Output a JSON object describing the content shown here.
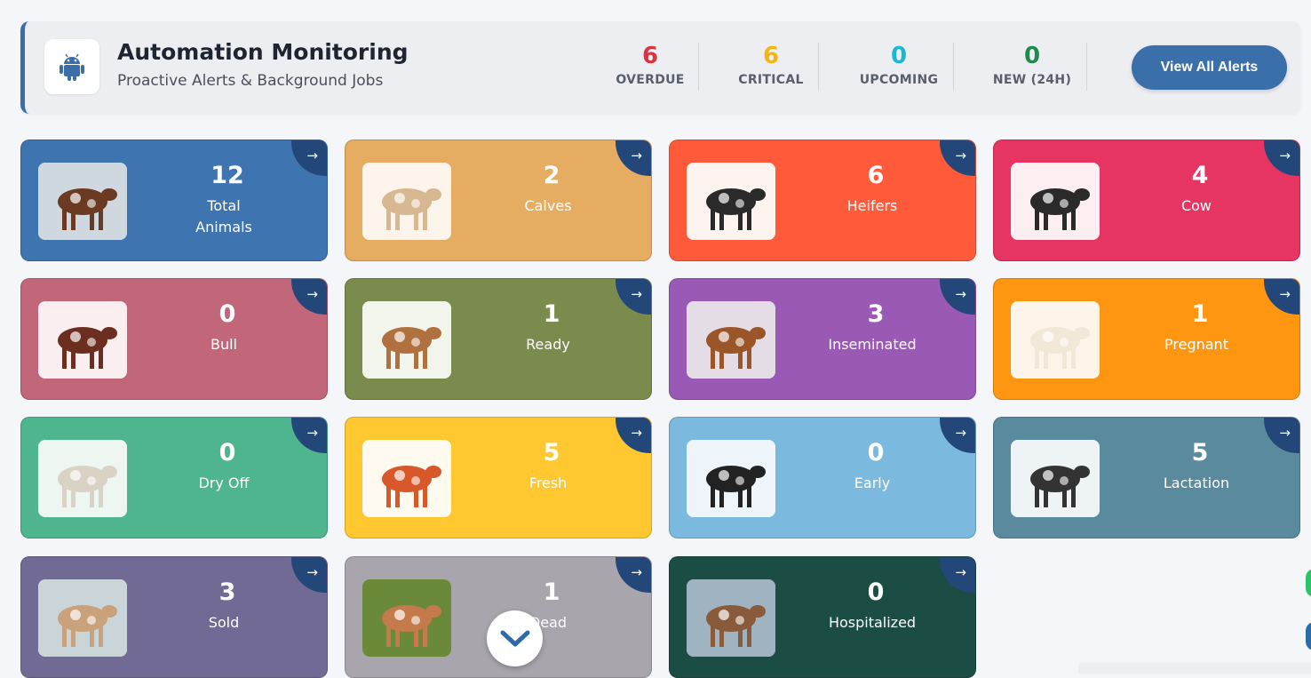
{
  "header": {
    "title": "Automation Monitoring",
    "subtitle": "Proactive Alerts & Background Jobs",
    "logo_icon": "android-icon",
    "stats": [
      {
        "value": "6",
        "label": "OVERDUE",
        "color": "#e0313e"
      },
      {
        "value": "6",
        "label": "CRITICAL",
        "color": "#f5b50f"
      },
      {
        "value": "0",
        "label": "UPCOMING",
        "color": "#19b7d4"
      },
      {
        "value": "0",
        "label": "NEW (24H)",
        "color": "#1f8a4c"
      }
    ],
    "view_all_label": "View All Alerts"
  },
  "cards": [
    {
      "count": "12",
      "label": "Total\nAnimals",
      "color": "#3e75b0",
      "icon": "herd-icon"
    },
    {
      "count": "2",
      "label": "Calves",
      "color": "#e6ad62",
      "icon": "calf-icon"
    },
    {
      "count": "6",
      "label": "Heifers",
      "color": "#ff5b3a",
      "icon": "heifer-icon"
    },
    {
      "count": "4",
      "label": "Cow",
      "color": "#e63562",
      "icon": "cow-icon"
    },
    {
      "count": "0",
      "label": "Bull",
      "color": "#c2667a",
      "icon": "bull-icon"
    },
    {
      "count": "1",
      "label": "Ready",
      "color": "#7b8a4d",
      "icon": "ready-cow-icon"
    },
    {
      "count": "3",
      "label": "Inseminated",
      "color": "#9b59b6",
      "icon": "inseminated-cow-icon"
    },
    {
      "count": "1",
      "label": "Pregnant",
      "color": "#ff9611",
      "icon": "pregnant-cow-icon"
    },
    {
      "count": "0",
      "label": "Dry Off",
      "color": "#4fb58e",
      "icon": "dry-off-cow-icon"
    },
    {
      "count": "5",
      "label": "Fresh",
      "color": "#ffc730",
      "icon": "fresh-cow-icon"
    },
    {
      "count": "0",
      "label": "Early",
      "color": "#7cb9de",
      "icon": "early-cow-icon"
    },
    {
      "count": "5",
      "label": "Lactation",
      "color": "#5a8a9e",
      "icon": "lactation-cow-icon"
    },
    {
      "count": "3",
      "label": "Sold",
      "color": "#716a94",
      "icon": "sold-cows-icon"
    },
    {
      "count": "1",
      "label": "Dead",
      "color": "#a9a5ad",
      "icon": "dead-cow-icon"
    },
    {
      "count": "0",
      "label": "Hospitalized",
      "color": "#1c4d45",
      "icon": "hospitalized-cow-icon"
    }
  ],
  "card_arrow": "→",
  "scroll_icon": "chevron-down-icon"
}
